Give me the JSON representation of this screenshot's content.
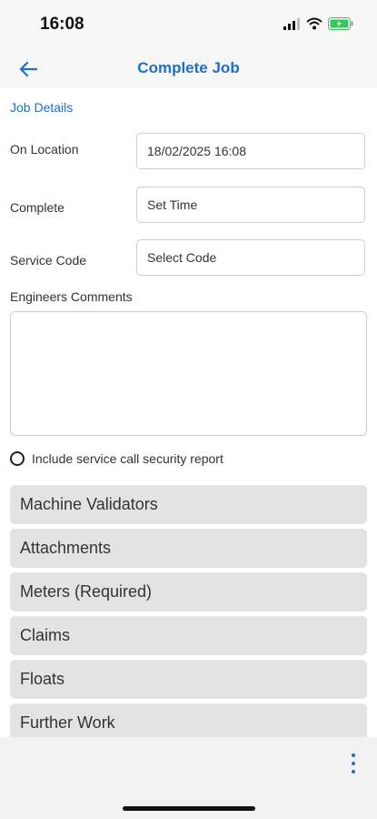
{
  "status_bar": {
    "time": "16:08",
    "icons": [
      "signal-icon",
      "wifi-icon",
      "battery-charging-icon"
    ]
  },
  "nav": {
    "title": "Complete Job",
    "back_icon": "back-arrow-icon"
  },
  "section_link": "Job Details",
  "form": {
    "on_location": {
      "label": "On Location",
      "value": "18/02/2025 16:08"
    },
    "complete": {
      "label": "Complete",
      "placeholder": "Set Time"
    },
    "service_code": {
      "label": "Service Code",
      "placeholder": "Select Code"
    },
    "comments": {
      "label": "Engineers Comments",
      "value": ""
    },
    "security_report": {
      "label": "Include service call security report",
      "checked": false
    }
  },
  "sections": [
    {
      "label": "Machine Validators"
    },
    {
      "label": "Attachments"
    },
    {
      "label": "Meters (Required)"
    },
    {
      "label": "Claims"
    },
    {
      "label": "Floats"
    },
    {
      "label": "Further Work"
    }
  ],
  "colors": {
    "accent": "#1e6fc9",
    "accordion_bg": "#e3e3e3",
    "battery_green": "#34c759"
  }
}
